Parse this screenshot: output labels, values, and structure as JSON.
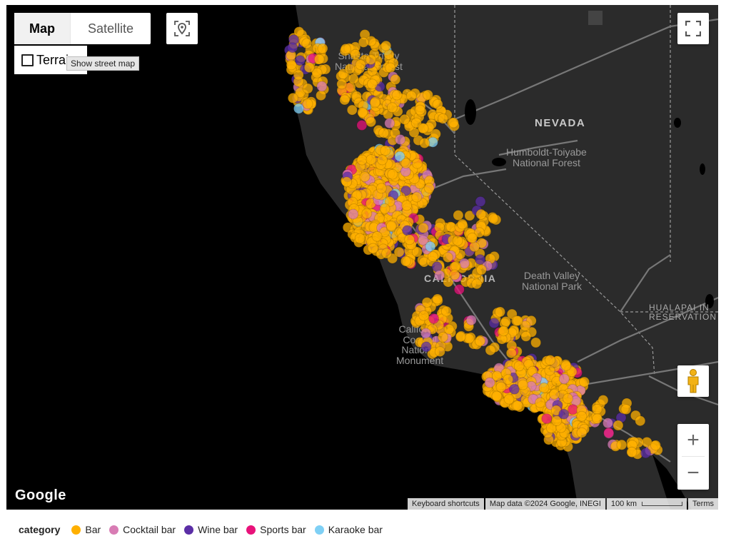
{
  "map": {
    "type_controls": {
      "map_label": "Map",
      "satellite_label": "Satellite",
      "terrain_label": "Terrain"
    },
    "tooltip": "Show street map",
    "icons": [
      "location-pin-icon",
      "fullscreen-icon",
      "pegman-icon",
      "zoom-in-icon",
      "zoom-out-icon"
    ],
    "zoom_in_label": "+",
    "zoom_out_label": "−",
    "google_logo": "Google",
    "attribution": {
      "keyboard_shortcuts": "Keyboard shortcuts",
      "map_data": "Map data ©2024 Google, INEGI",
      "scale": "100 km",
      "terms": "Terms"
    },
    "place_labels": {
      "nevada": "NEVADA",
      "shasta": "Shasta-Trinity\nNational Forest",
      "humboldt": "Humboldt-Toiyabe\nNational Forest",
      "california": "CALIFORNIA",
      "death_valley": "Death Valley\nNational Park",
      "hualapai": "HUALAPAI IN\nRESERVATION",
      "carrizo": "California\nCoastal\nNational\nMonument"
    },
    "colors": {
      "land": "#2b2b2b",
      "water": "#000000",
      "roads": "#7a7a7a",
      "borders": "#9a9a9a"
    }
  },
  "legend": {
    "title": "category",
    "items": [
      {
        "label": "Bar",
        "color": "#FFB000"
      },
      {
        "label": "Cocktail bar",
        "color": "#D87CB4"
      },
      {
        "label": "Wine bar",
        "color": "#5B2EA6"
      },
      {
        "label": "Sports bar",
        "color": "#E8127A"
      },
      {
        "label": "Karaoke bar",
        "color": "#7FD0F5"
      }
    ]
  }
}
